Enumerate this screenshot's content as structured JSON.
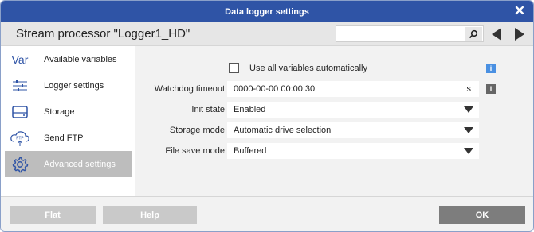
{
  "window": {
    "title": "Data logger settings"
  },
  "header": {
    "title": "Stream processor \"Logger1_HD\"",
    "search_placeholder": ""
  },
  "sidebar": {
    "items": [
      {
        "label": "Available variables",
        "icon": "var-icon",
        "icon_text": "Var"
      },
      {
        "label": "Logger settings",
        "icon": "sliders-icon"
      },
      {
        "label": "Storage",
        "icon": "drive-icon"
      },
      {
        "label": "Send FTP",
        "icon": "cloud-upload-icon",
        "icon_text": "FTP"
      },
      {
        "label": "Advanced settings",
        "icon": "gear-icon",
        "active": true
      }
    ]
  },
  "main": {
    "use_all_label": "Use all variables automatically",
    "use_all_checked": false,
    "watchdog": {
      "label": "Watchdog timeout",
      "value": "0000-00-00 00:00:30",
      "unit": "s"
    },
    "init_state": {
      "label": "Init state",
      "value": "Enabled"
    },
    "storage_mode": {
      "label": "Storage mode",
      "value": "Automatic drive selection"
    },
    "file_save_mode": {
      "label": "File save mode",
      "value": "Buffered"
    },
    "info_glyph": "i"
  },
  "footer": {
    "flat_label": "Flat",
    "help_label": "Help",
    "ok_label": "OK"
  },
  "colors": {
    "titlebar": "#2f54a6",
    "active_item": "#bdbdbd",
    "info_blue": "#4a90e2",
    "info_dark": "#666666"
  }
}
